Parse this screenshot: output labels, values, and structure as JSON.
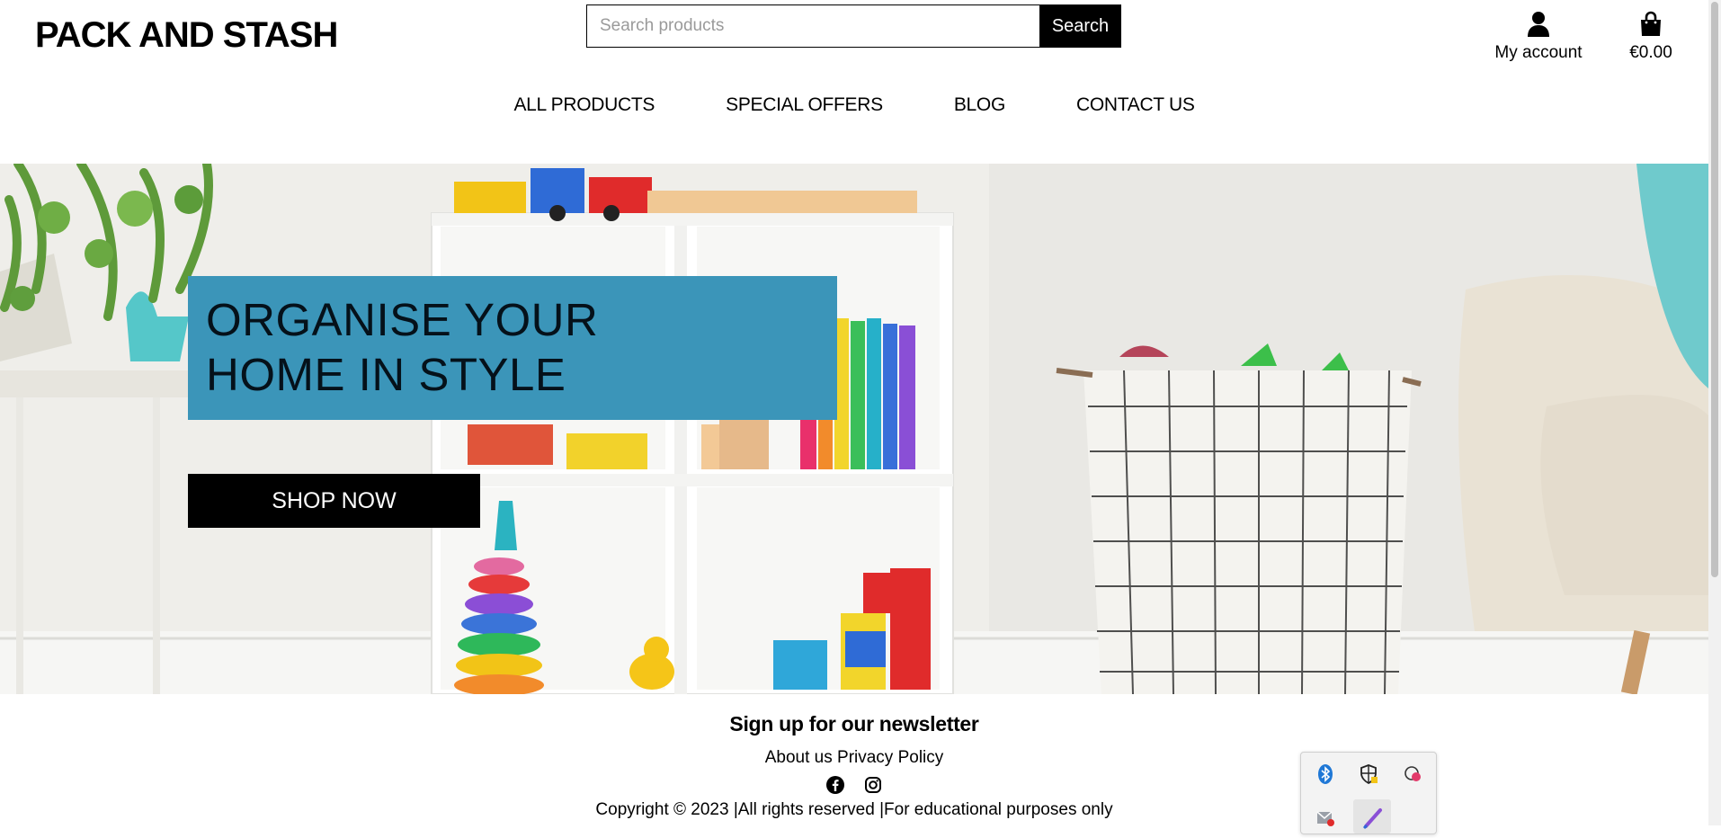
{
  "header": {
    "brand": "PACK AND STASH",
    "search_placeholder": "Search products",
    "search_button": "Search",
    "account_label": "My account",
    "account_icon": "user-icon",
    "cart_total": "€0.00",
    "cart_icon": "shopping-bag-icon"
  },
  "nav": {
    "items": [
      {
        "label": "ALL PRODUCTS"
      },
      {
        "label": "SPECIAL OFFERS"
      },
      {
        "label": "BLOG"
      },
      {
        "label": "CONTACT US"
      }
    ]
  },
  "hero": {
    "headline": "ORGANISE YOUR\nHOME IN STYLE",
    "cta": "SHOP NOW",
    "accent_color": "#3b95b9"
  },
  "footer": {
    "newsletter": "Sign up for our newsletter",
    "links": [
      "About us",
      "Privacy Policy"
    ],
    "social_icons": [
      "facebook-icon",
      "instagram-icon"
    ],
    "copyright": "Copyright © 2023 |All rights reserved |For educational purposes only"
  },
  "tray": {
    "icons": [
      "bluetooth-icon",
      "security-shield-icon",
      "cookie-app-icon",
      "mail-app-icon",
      "pen-app-icon"
    ]
  }
}
